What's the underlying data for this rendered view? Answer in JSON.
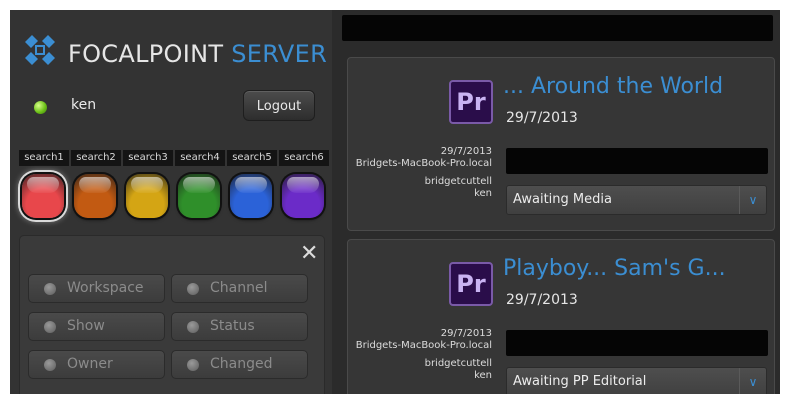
{
  "app": {
    "brand_word1": "FOCALPOINT",
    "brand_word2": "SERVER",
    "accent_color": "#3b8ed2"
  },
  "session": {
    "status_color": "#6ec219",
    "username": "ken",
    "logout_label": "Logout"
  },
  "searches": [
    {
      "label": "search1",
      "color": "#e8474b",
      "selected": true
    },
    {
      "label": "search2",
      "color": "#c25a12"
    },
    {
      "label": "search3",
      "color": "#d4a514"
    },
    {
      "label": "search4",
      "color": "#2f8f2a"
    },
    {
      "label": "search5",
      "color": "#2b62d8"
    },
    {
      "label": "search6",
      "color": "#6b2bc8"
    }
  ],
  "filters": {
    "close_icon": "close-icon",
    "buttons": [
      {
        "label": "Workspace"
      },
      {
        "label": "Channel"
      },
      {
        "label": "Show"
      },
      {
        "label": "Status"
      },
      {
        "label": "Owner"
      },
      {
        "label": "Changed"
      }
    ]
  },
  "cards": [
    {
      "app_icon": "Pr",
      "title": "... Around the World",
      "date": "29/7/2013",
      "meta_date": "29/7/2013",
      "meta_machine": "Bridgets-MacBook-Pro.local",
      "meta_user": "bridgetcuttell",
      "meta_owner": "ken",
      "status": "Awaiting Media"
    },
    {
      "app_icon": "Pr",
      "title": "Playboy... Sam's G...",
      "date": "29/7/2013",
      "meta_date": "29/7/2013",
      "meta_machine": "Bridgets-MacBook-Pro.local",
      "meta_user": "bridgetcuttell",
      "meta_owner": "ken",
      "status": "Awaiting PP Editorial"
    }
  ]
}
